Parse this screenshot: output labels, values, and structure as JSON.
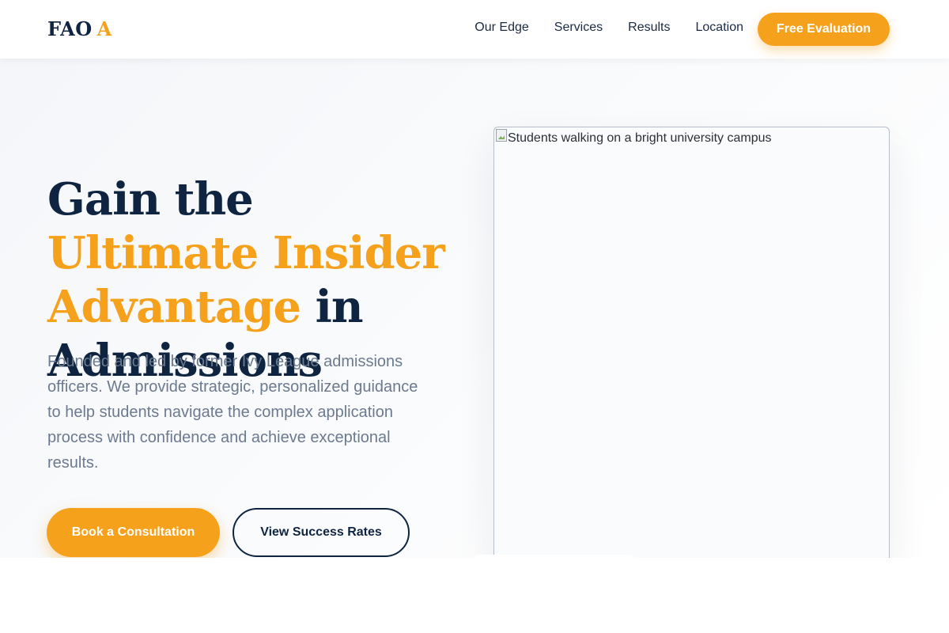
{
  "header": {
    "logo_text": "FAO",
    "logo_accent": "A",
    "nav": [
      {
        "label": "Our Edge"
      },
      {
        "label": "Services"
      },
      {
        "label": "Results"
      },
      {
        "label": "Location"
      }
    ],
    "cta_label": "Free Evaluation"
  },
  "hero": {
    "headline_part1": "Gain the ",
    "headline_accent": "Ultimate Insider Advantage",
    "headline_part2": " in Admissions",
    "description": "Founded and led by former Ivy League admissions officers. We provide strategic, personalized guidance to help students navigate the complex application process with confidence and achieve exceptional results.",
    "primary_button": "Book a Consultation",
    "secondary_button": "View Success Rates",
    "image_alt": "Students walking on a bright university campus"
  },
  "colors": {
    "brand_navy": "#0f2440",
    "accent_orange": "#f6a11c",
    "body_text": "#6b7a8f"
  },
  "icons": {
    "broken_image": "broken-image-icon"
  }
}
